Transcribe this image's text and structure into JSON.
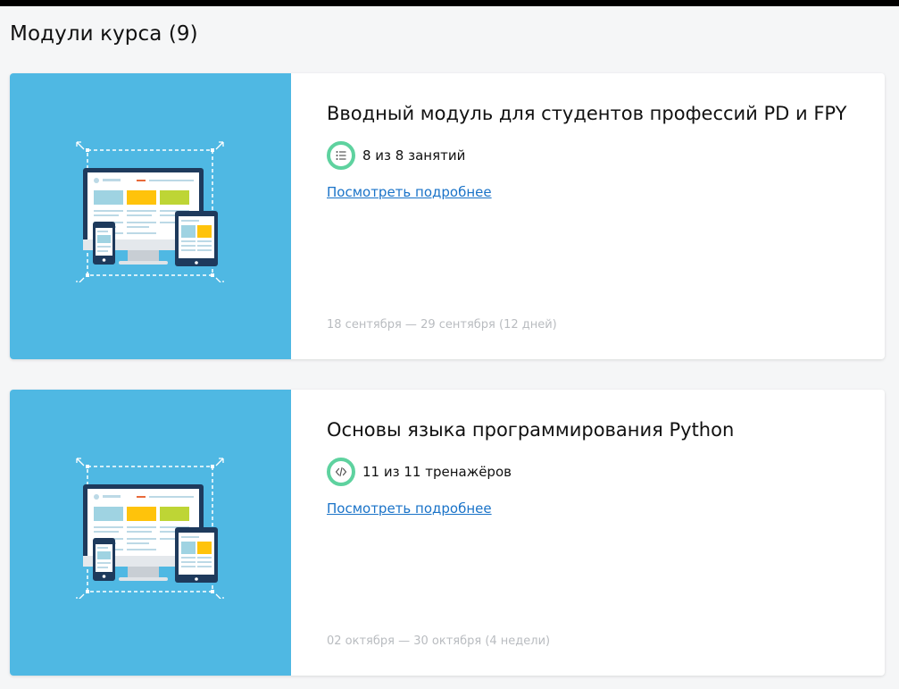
{
  "header": {
    "title": "Модули курса (9)"
  },
  "modules": [
    {
      "title": "Вводный модуль для студентов профессий PD и FPY",
      "progress_icon": "list-icon",
      "progress_text": "8 из 8 занятий",
      "link_label": "Посмотреть подробнее",
      "dates": "18 сентября — 29 сентября (12 дней)"
    },
    {
      "title": "Основы языка программирования Python",
      "progress_icon": "code-icon",
      "progress_text": "11 из 11 тренажёров",
      "link_label": "Посмотреть подробнее",
      "dates": "02 октября — 30 октября (4 недели)"
    }
  ],
  "colors": {
    "thumb_background": "#4fb8e3",
    "progress_ring": "#5ed29f",
    "link": "#1a73c8",
    "dates": "#b9bcc0"
  }
}
